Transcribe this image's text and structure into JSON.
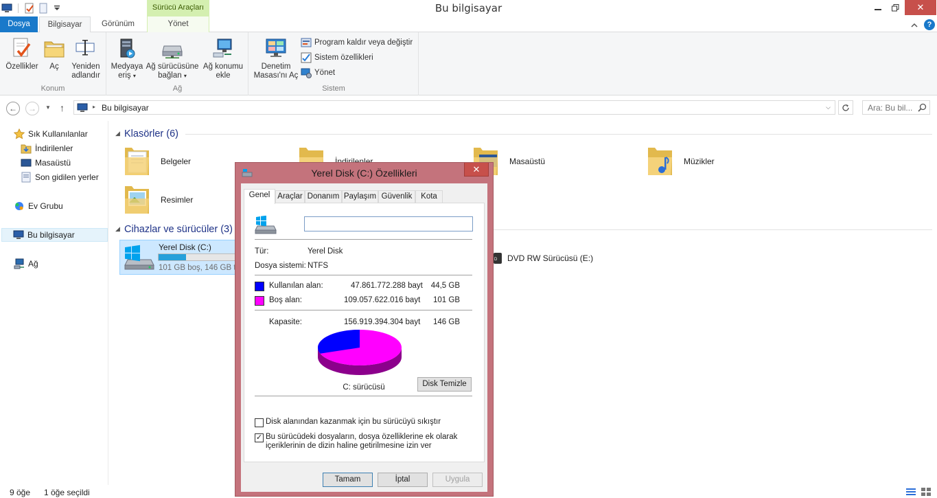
{
  "window": {
    "title": "Bu bilgisayar",
    "context_tab_group": "Sürücü Araçları"
  },
  "tabs": {
    "file": "Dosya",
    "computer": "Bilgisayar",
    "view": "Görünüm",
    "manage": "Yönet"
  },
  "ribbon": {
    "location": {
      "label": "Konum",
      "properties": "Özellikler",
      "open": "Aç",
      "rename_line1": "Yeniden",
      "rename_line2": "adlandır"
    },
    "network": {
      "label": "Ağ",
      "media_line1": "Medyaya",
      "media_line2": "eriş",
      "map_line1": "Ağ sürücüsüne",
      "map_line2": "bağlan",
      "add_line1": "Ağ konumu",
      "add_line2": "ekle"
    },
    "system": {
      "label": "Sistem",
      "control_line1": "Denetim",
      "control_line2": "Masası'nı Aç",
      "uninstall": "Program kaldır veya değiştir",
      "sysprops": "Sistem özellikleri",
      "manage": "Yönet"
    }
  },
  "address": {
    "path": "Bu bilgisayar",
    "search_placeholder": "Ara: Bu bil..."
  },
  "nav": {
    "favorites": "Sık Kullanılanlar",
    "downloads": "İndirilenler",
    "desktop": "Masaüstü",
    "recent": "Son gidilen yerler",
    "homegroup": "Ev Grubu",
    "thispc": "Bu bilgisayar",
    "network": "Ağ"
  },
  "content": {
    "folders_title": "Klasörler (6)",
    "folders": [
      "Belgeler",
      "İndirilenler",
      "Masaüstü",
      "Müzikler",
      "Resimler"
    ],
    "devices_title": "Cihazlar ve sürücüler (3)",
    "drive_c": {
      "name": "Yerel Disk (C:)",
      "free_text": "101 GB boş, 146 GB toplam",
      "used_fraction": 0.305
    },
    "drive_e": {
      "name": "DVD RW Sürücüsü (E:)"
    }
  },
  "status": {
    "items": "9 öğe",
    "selected": "1 öğe seçildi"
  },
  "dialog": {
    "title": "Yerel Disk (C:) Özellikleri",
    "tabs": [
      "Genel",
      "Araçlar",
      "Donanım",
      "Paylaşım",
      "Güvenlik",
      "Kota"
    ],
    "name_value": "",
    "type_label": "Tür:",
    "type_value": "Yerel Disk",
    "fs_label": "Dosya sistemi:",
    "fs_value": "NTFS",
    "used_label": "Kullanılan alan:",
    "used_bytes": "47.861.772.288 bayt",
    "used_gb": "44,5 GB",
    "free_label": "Boş alan:",
    "free_bytes": "109.057.622.016 bayt",
    "free_gb": "101 GB",
    "cap_label": "Kapasite:",
    "cap_bytes": "156.919.394.304 bayt",
    "cap_gb": "146 GB",
    "drive_label": "C: sürücüsü",
    "cleanup_button": "Disk Temizle",
    "compress_label": "Disk alanından kazanmak için bu sürücüyü sıkıştır",
    "compress_checked": false,
    "index_label_line1": "Bu sürücüdeki dosyaların, dosya özelliklerine ek olarak",
    "index_label_line2": "içeriklerinin de dizin haline getirilmesine izin ver",
    "index_checked": true,
    "ok": "Tamam",
    "cancel": "İptal",
    "apply": "Uygula",
    "used_color": "#0000ff",
    "free_color": "#ff00ff"
  }
}
